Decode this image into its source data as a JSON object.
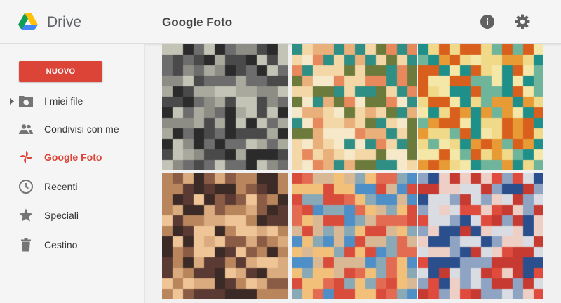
{
  "header": {
    "app_name": "Drive",
    "page_title": "Google Foto",
    "actions": [
      {
        "icon": "info-icon"
      },
      {
        "icon": "gear-icon"
      }
    ]
  },
  "sidebar": {
    "new_button": "NUOVO",
    "items": [
      {
        "label": "I miei file",
        "icon": "drive-folder-icon",
        "has_expander": true
      },
      {
        "label": "Condivisi con me",
        "icon": "people-icon"
      },
      {
        "label": "Google Foto",
        "icon": "google-photos-icon",
        "active": true
      },
      {
        "label": "Recenti",
        "icon": "clock-icon"
      },
      {
        "label": "Speciali",
        "icon": "star-icon"
      },
      {
        "label": "Cestino",
        "icon": "trash-icon"
      }
    ]
  },
  "colors": {
    "accent": "#db4437",
    "sidebar_bg": "#f5f5f5",
    "content_bg": "#f1f1f1",
    "icon_gray": "#757575"
  },
  "photos": [
    {
      "palette": [
        "#2b2b2b",
        "#4a4a4a",
        "#6d6d6d",
        "#8d8d86",
        "#a9a99e",
        "#c4c4b6"
      ]
    },
    {
      "palette": [
        "#f3d7a6",
        "#e9b07b",
        "#e8885d",
        "#6c7a3c",
        "#2f8f85",
        "#f5e9c9"
      ]
    },
    {
      "palette": [
        "#f1d98a",
        "#e89a35",
        "#d9601c",
        "#1f8f8a",
        "#6fb59b",
        "#f5e7a8"
      ]
    },
    {
      "palette": [
        "#5a3a32",
        "#8a5c45",
        "#b9855d",
        "#d9ab7e",
        "#efc597",
        "#3b2a25"
      ]
    },
    {
      "palette": [
        "#f3c07a",
        "#e36b52",
        "#d94b3b",
        "#8aa9b7",
        "#d9b995",
        "#4f8fc7"
      ]
    },
    {
      "palette": [
        "#d9dde3",
        "#8fa4c2",
        "#2b4f8c",
        "#df4b3c",
        "#c63a31",
        "#eecfc6"
      ]
    }
  ]
}
